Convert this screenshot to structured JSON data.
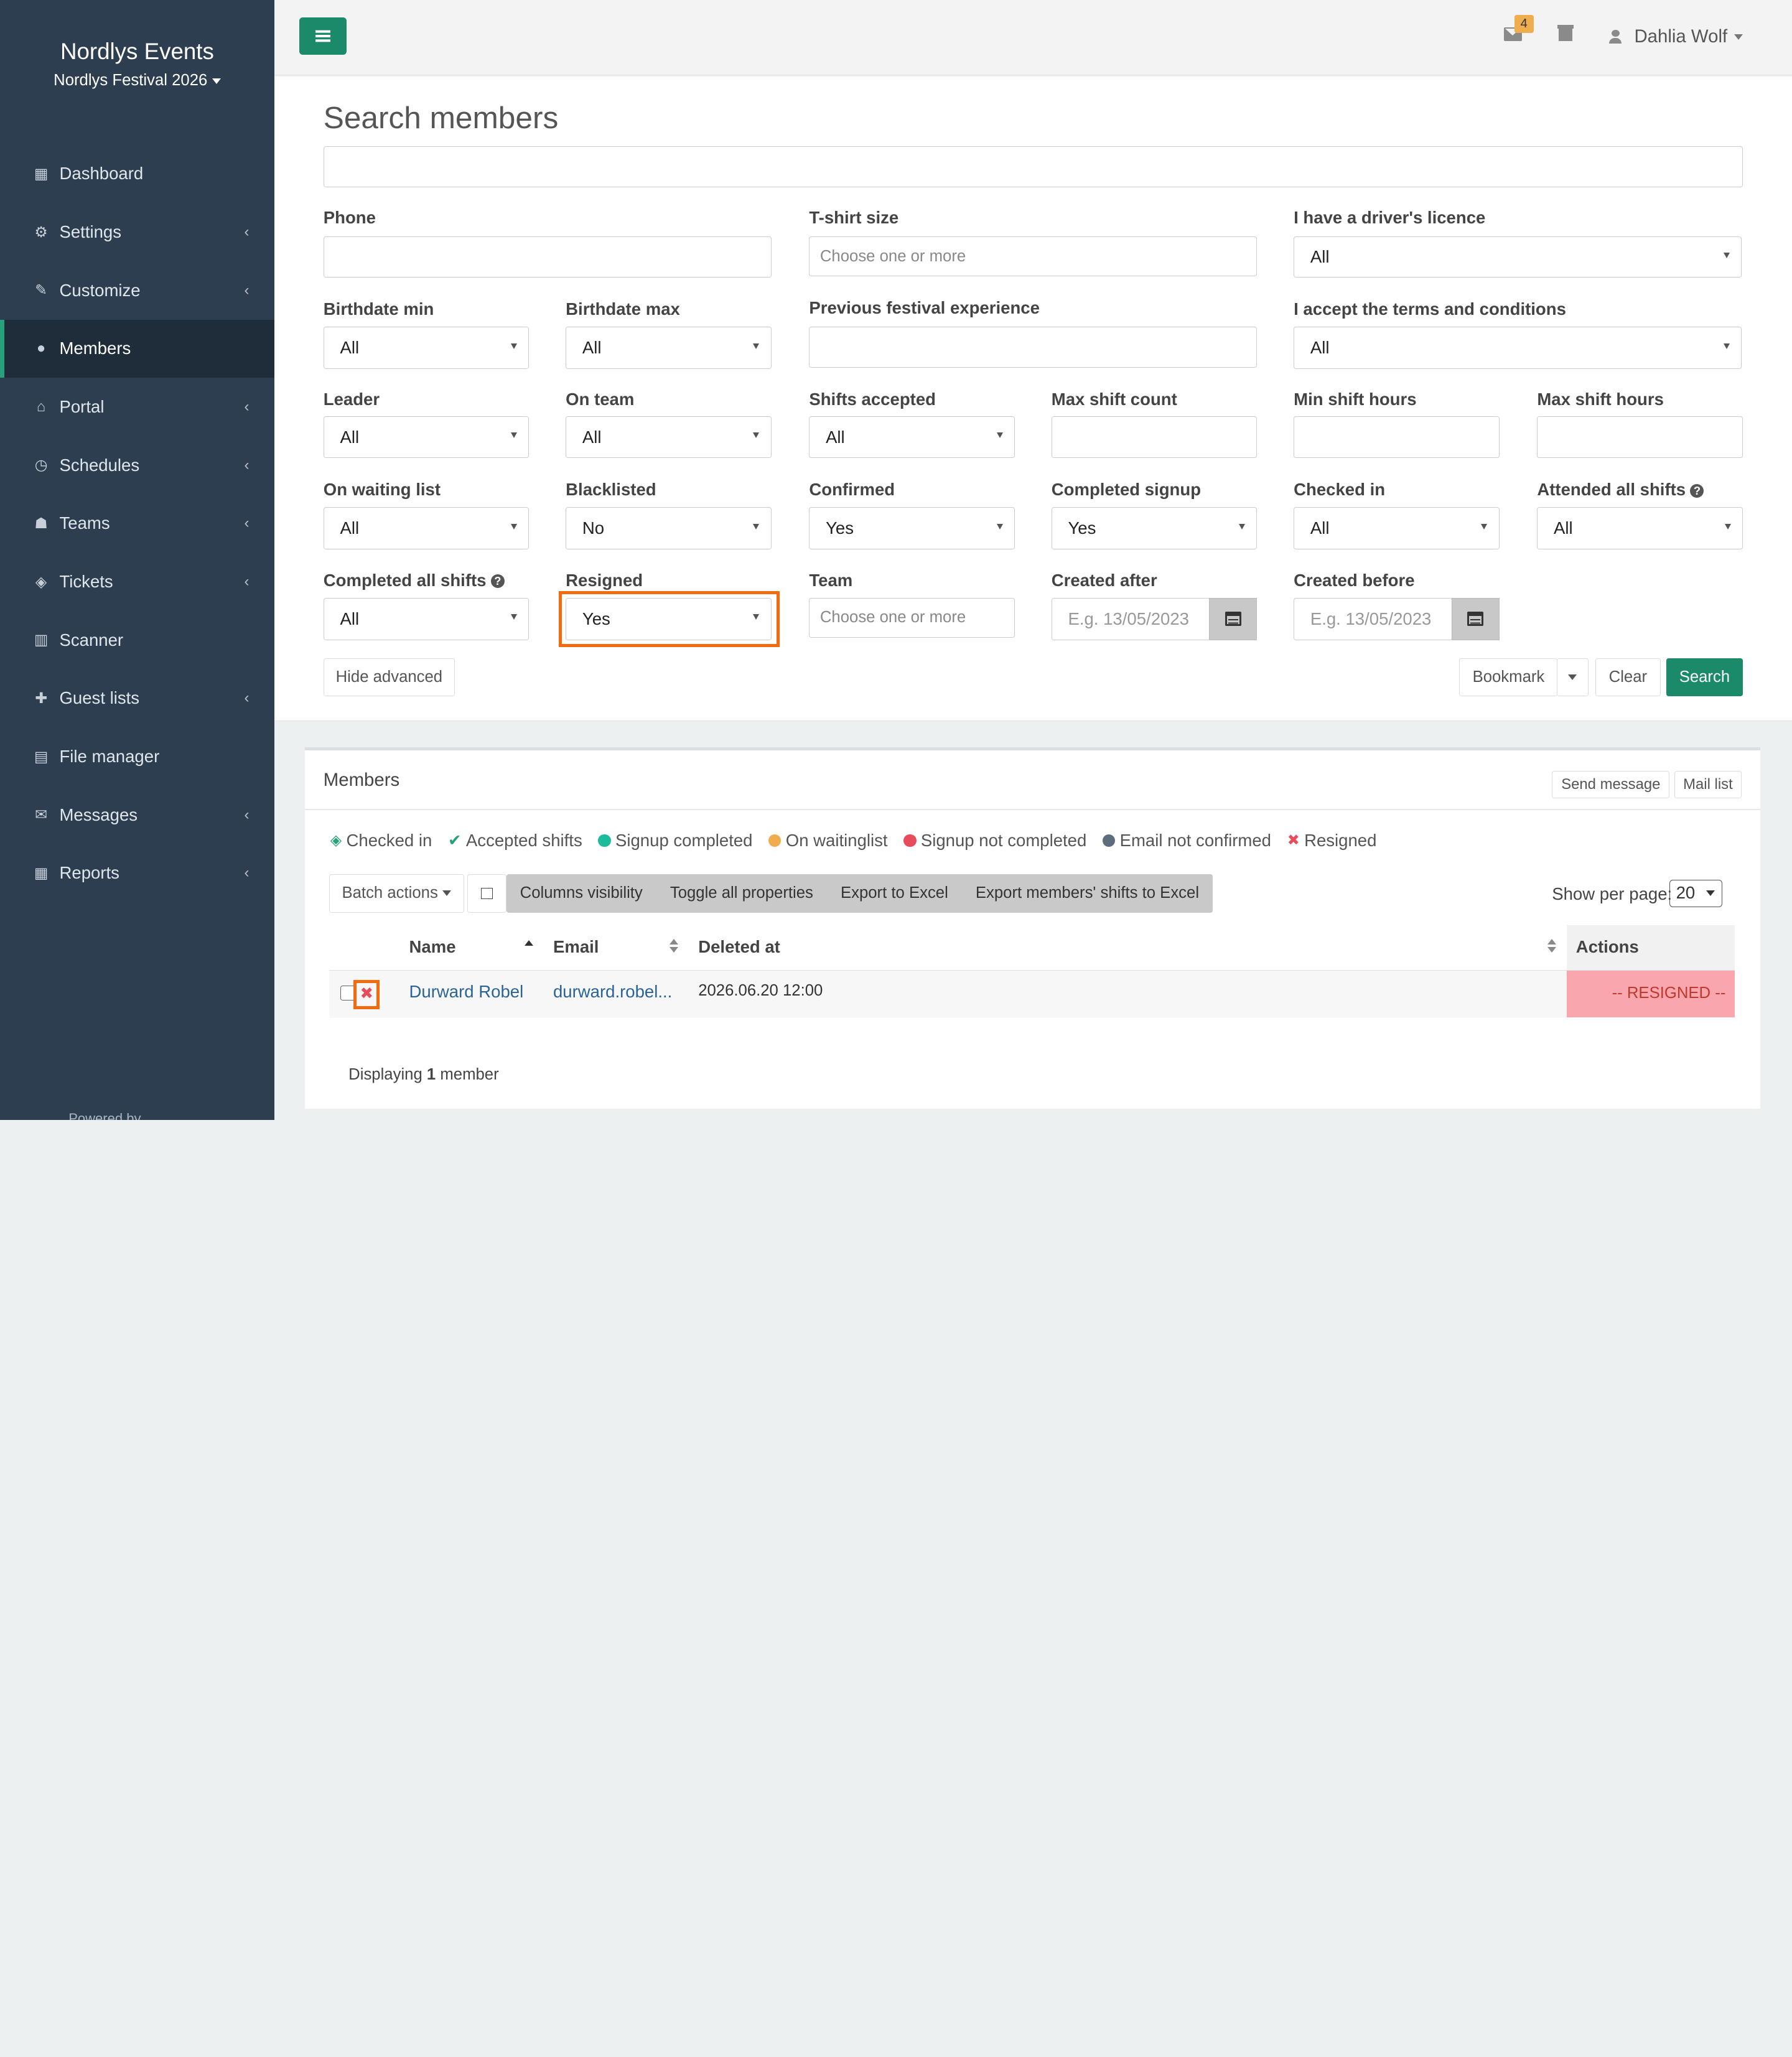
{
  "sidebar": {
    "org_name": "Nordlys Events",
    "event_name": "Nordlys Festival 2026",
    "items": [
      {
        "label": "Dashboard",
        "icon": "calendar-icon"
      },
      {
        "label": "Settings",
        "icon": "cogs-icon"
      },
      {
        "label": "Customize",
        "icon": "brush-icon"
      },
      {
        "label": "Members",
        "icon": "user-icon"
      },
      {
        "label": "Portal",
        "icon": "home-icon"
      },
      {
        "label": "Schedules",
        "icon": "clock-icon"
      },
      {
        "label": "Teams",
        "icon": "users-icon"
      },
      {
        "label": "Tickets",
        "icon": "tags-icon"
      },
      {
        "label": "Scanner",
        "icon": "barcode-icon"
      },
      {
        "label": "Guest lists",
        "icon": "user-plus-icon"
      },
      {
        "label": "File manager",
        "icon": "file-icon"
      },
      {
        "label": "Messages",
        "icon": "comments-icon"
      },
      {
        "label": "Reports",
        "icon": "table-icon"
      }
    ],
    "active": "Members",
    "powered_by": "Powered by"
  },
  "topbar": {
    "mail_count": "4",
    "user_name": "Dahlia Wolf"
  },
  "search": {
    "title": "Search members",
    "query_value": "",
    "fields": {
      "phone": {
        "label": "Phone",
        "value": ""
      },
      "tshirt": {
        "label": "T-shirt size",
        "placeholder": "Choose one or more"
      },
      "driver": {
        "label": "I have a driver's licence",
        "value": "All"
      },
      "bdate_min": {
        "label": "Birthdate min",
        "value": "All"
      },
      "bdate_max": {
        "label": "Birthdate max",
        "value": "All"
      },
      "prev_exp": {
        "label": "Previous festival experience",
        "value": ""
      },
      "terms": {
        "label": "I accept the terms and conditions",
        "value": "All"
      },
      "leader": {
        "label": "Leader",
        "value": "All"
      },
      "on_team": {
        "label": "On team",
        "value": "All"
      },
      "shifts_accepted": {
        "label": "Shifts accepted",
        "value": "All"
      },
      "max_shift_count": {
        "label": "Max shift count",
        "value": ""
      },
      "min_shift_hours": {
        "label": "Min shift hours",
        "value": ""
      },
      "max_shift_hours": {
        "label": "Max shift hours",
        "value": ""
      },
      "waiting": {
        "label": "On waiting list",
        "value": "All"
      },
      "blacklisted": {
        "label": "Blacklisted",
        "value": "No"
      },
      "confirmed": {
        "label": "Confirmed",
        "value": "Yes"
      },
      "completed_signup": {
        "label": "Completed signup",
        "value": "Yes"
      },
      "checked_in": {
        "label": "Checked in",
        "value": "All"
      },
      "attended_all": {
        "label": "Attended all shifts",
        "value": "All"
      },
      "completed_all": {
        "label": "Completed all shifts",
        "value": "All"
      },
      "resigned": {
        "label": "Resigned",
        "value": "Yes"
      },
      "team": {
        "label": "Team",
        "placeholder": "Choose one or more"
      },
      "created_after": {
        "label": "Created after",
        "placeholder": "E.g. 13/05/2023"
      },
      "created_before": {
        "label": "Created before",
        "placeholder": "E.g. 13/05/2023"
      }
    },
    "buttons": {
      "hide_advanced": "Hide advanced",
      "bookmark": "Bookmark",
      "clear": "Clear",
      "search": "Search"
    }
  },
  "members": {
    "title": "Members",
    "send_message": "Send message",
    "mail_list": "Mail list",
    "legend": [
      {
        "label": "Checked in",
        "color": "#26a17b",
        "icon": "ticket-icon"
      },
      {
        "label": "Accepted shifts",
        "color": "#26a17b",
        "icon": "check-icon"
      },
      {
        "label": "Signup completed",
        "color": "#1abc9c",
        "icon": "dot-icon"
      },
      {
        "label": "On waitinglist",
        "color": "#f0ad4e",
        "icon": "dot-icon"
      },
      {
        "label": "Signup not completed",
        "color": "#e74c5c",
        "icon": "dot-icon"
      },
      {
        "label": "Email not confirmed",
        "color": "#5d6d7e",
        "icon": "dot-icon"
      },
      {
        "label": "Resigned",
        "color": "#e74c5c",
        "icon": "x-icon"
      }
    ],
    "batch_actions": "Batch actions",
    "toolbar": [
      "Columns visibility",
      "Toggle all properties",
      "Export to Excel",
      "Export members' shifts to Excel"
    ],
    "per_page_label": "Show per page:",
    "per_page_value": "20",
    "columns": {
      "name": "Name",
      "email": "Email",
      "deleted_at": "Deleted at",
      "actions": "Actions"
    },
    "rows": [
      {
        "name": "Durward Robel",
        "email": "durward.robel...",
        "deleted_at": "2026.06.20 12:00",
        "action": "-- RESIGNED --"
      }
    ],
    "displaying_prefix": "Displaying",
    "displaying_count": "1",
    "displaying_suffix": "member"
  },
  "colors": {
    "sidebar_bg": "#2c3e50",
    "accent": "#1b8a6b",
    "highlight": "#f26b0f",
    "resigned_bg": "#f9a6ae"
  }
}
